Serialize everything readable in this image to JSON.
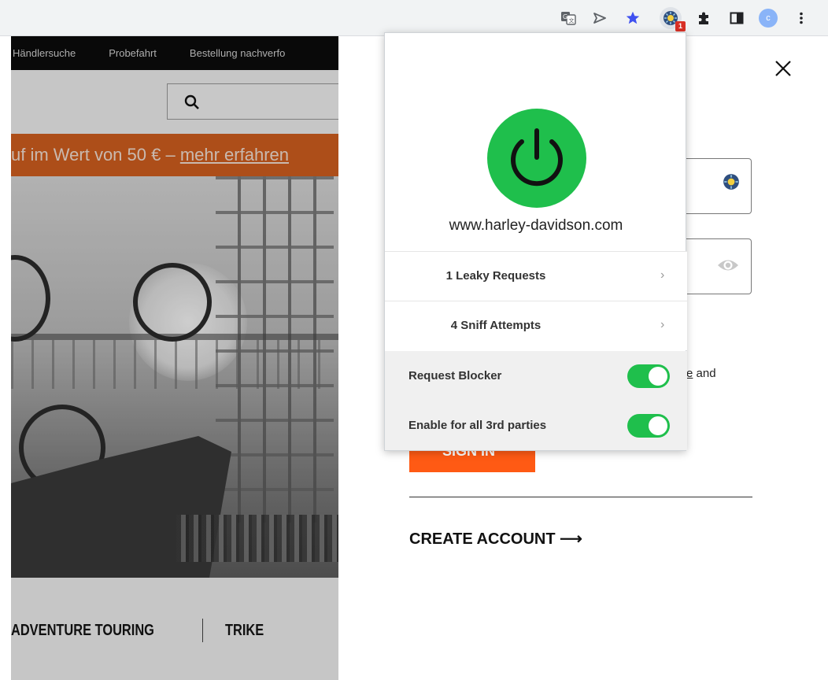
{
  "browser": {
    "toolbar_icons": [
      "translate-icon",
      "send-tab-icon",
      "bookmark-star-icon",
      "extension-icon",
      "extensions-puzzle-icon",
      "side-panel-icon",
      "profile-avatar",
      "more-menu-icon"
    ],
    "extension_badge": "1",
    "profile_initial": "c",
    "star_color": "#3f51f0"
  },
  "site": {
    "nav": [
      "Händlersuche",
      "Probefahrt",
      "Bestellung nachverfo"
    ],
    "banner_text": "uf im Wert von 50 € – ",
    "banner_link": "mehr erfahren",
    "categories": [
      "ADVENTURE TOURING",
      "TRIKE"
    ]
  },
  "login": {
    "terms_link_fragment": "e",
    "terms_suffix": " and",
    "signin_label": "SIGN IN",
    "create_account_label": "CREATE ACCOUNT ⟶"
  },
  "popup": {
    "domain": "www.harley-davidson.com",
    "rows": [
      {
        "label": "1 Leaky Requests",
        "chevron": "›"
      },
      {
        "label": "4 Sniff Attempts",
        "chevron": "›"
      }
    ],
    "toggles": [
      {
        "label": "Request Blocker",
        "on": true
      },
      {
        "label": "Enable for all 3rd parties",
        "on": true
      }
    ],
    "accent": "#1fbf4c"
  }
}
